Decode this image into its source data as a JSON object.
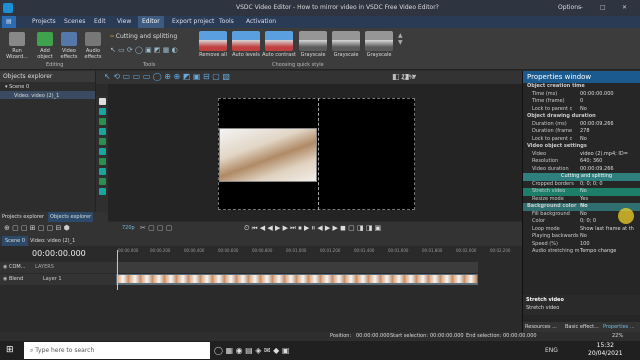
{
  "window": {
    "title": "VSDC Video Editor - How to mirror video in VSDC Free Video Editor?",
    "options": "Options"
  },
  "menu": [
    "Projects",
    "Scenes",
    "Edit",
    "View",
    "Editor",
    "Export project",
    "Tools",
    "Activation"
  ],
  "ribbon": {
    "run_wizard": "Run Wizard...",
    "add_object": "Add object",
    "video_effects": "Video effects",
    "audio_effects": "Audio effects",
    "editing_group": "Editing",
    "cutting": "Cutting and splitting",
    "tools_group": "Tools",
    "quick_styles": [
      "Remove all",
      "Auto levels",
      "Auto contrast",
      "Grayscale",
      "Grayscale",
      "Grayscale"
    ],
    "quick_style_group": "Choosing quick style"
  },
  "objects_explorer": {
    "title": "Objects explorer",
    "scene": "Scene 0",
    "video_item": "Video: video (2)_1"
  },
  "canvas": {
    "zoom": "22%"
  },
  "panel_tabs": {
    "projects": "Projects explorer",
    "objects": "Objects explorer"
  },
  "timeline": {
    "tabs": [
      "Scene 0",
      "Video: video (2)_1"
    ],
    "resolution": "720p",
    "timecode": "00:00:00.000",
    "ruler": [
      "00:00.000",
      "00:00.200",
      "00:00.400",
      "00:00.600",
      "00:00.800",
      "00:01.000",
      "00:01.200",
      "00:01.400",
      "00:01.600",
      "00:01.800",
      "00:02.000",
      "00:02.200"
    ],
    "track1_mode": "COM...",
    "track1_label": "LAYERS",
    "track2_mode": "Blend",
    "track2_label": "Layer 1"
  },
  "properties": {
    "title": "Properties window",
    "rows": [
      {
        "k": "Object creation time",
        "sec": true
      },
      {
        "k": "Time (ms)",
        "v": "00:00:00.000"
      },
      {
        "k": "Time (frame)",
        "v": "0"
      },
      {
        "k": "Lock to parent c",
        "v": "No"
      },
      {
        "k": "Object drawing duration",
        "sec": true
      },
      {
        "k": "Duration (ms)",
        "v": "00:00:09.266"
      },
      {
        "k": "Duration (frame",
        "v": "278"
      },
      {
        "k": "Lock to parent c",
        "v": "No"
      },
      {
        "k": "Video object settings",
        "sec": true
      },
      {
        "k": "Video",
        "v": "video (2).mp4; ID="
      },
      {
        "k": "Resolution",
        "v": "640; 360"
      },
      {
        "k": "Video duration",
        "v": "00:00:09.266"
      },
      {
        "k": "",
        "v": "Cutting and splitting",
        "hl": true
      },
      {
        "k": "Cropped borders",
        "v": "0; 0; 0; 0"
      },
      {
        "k": "Stretch video",
        "v": "No",
        "sel": true
      },
      {
        "k": "Resize mode",
        "v": "Yes"
      },
      {
        "k": "Background color",
        "v": "No",
        "sec": true,
        "hl2": true
      },
      {
        "k": "Fill background",
        "v": "No"
      },
      {
        "k": "Color",
        "v": "0; 0; 0"
      },
      {
        "k": "Loop mode",
        "v": "Show last frame at th"
      },
      {
        "k": "Playing backwards",
        "v": "No"
      },
      {
        "k": "Speed (%)",
        "v": "100"
      },
      {
        "k": "Audio stretching m",
        "v": "Tempo change"
      }
    ],
    "help_title": "Stretch video",
    "help_text": "Stretch video",
    "bottom_tabs": [
      "Resources ...",
      "Basic effect...",
      "Properties ..."
    ]
  },
  "status": {
    "position": "Position:",
    "position_val": "00:00:00.000",
    "start": "Start selection:",
    "start_val": "00:00:00.000",
    "end": "End selection:",
    "end_val": "00:00:00.000",
    "zoom": "22%"
  },
  "taskbar": {
    "search": "Type here to search",
    "time": "15:32",
    "date": "20/04/2021",
    "lang": "ENG"
  }
}
